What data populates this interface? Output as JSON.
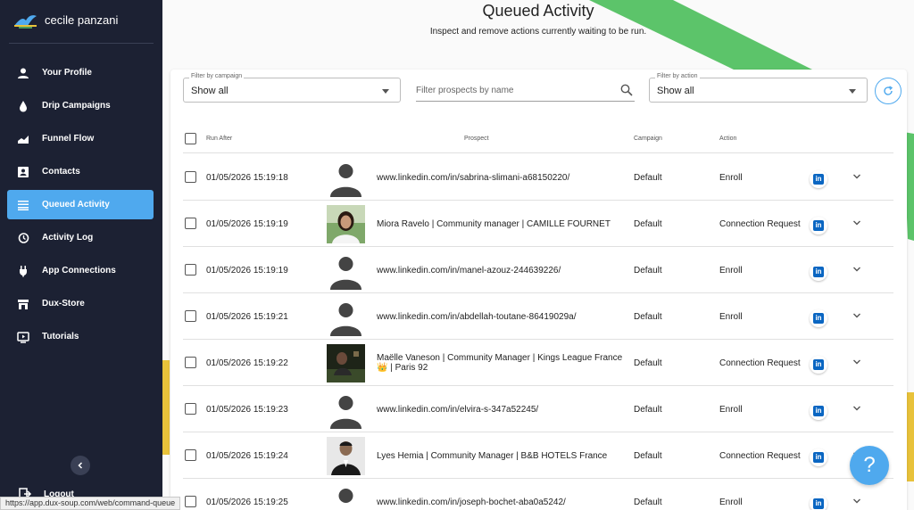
{
  "sidebar": {
    "user_name": "cecile panzani",
    "items": [
      {
        "label": "Your Profile",
        "icon": "person-icon",
        "active": false
      },
      {
        "label": "Drip Campaigns",
        "icon": "drop-icon",
        "active": false
      },
      {
        "label": "Funnel Flow",
        "icon": "chart-icon",
        "active": false
      },
      {
        "label": "Contacts",
        "icon": "contacts-icon",
        "active": false
      },
      {
        "label": "Queued Activity",
        "icon": "queue-icon",
        "active": true
      },
      {
        "label": "Activity Log",
        "icon": "history-icon",
        "active": false
      },
      {
        "label": "App Connections",
        "icon": "plug-icon",
        "active": false
      },
      {
        "label": "Dux-Store",
        "icon": "store-icon",
        "active": false
      },
      {
        "label": "Tutorials",
        "icon": "tutorial-icon",
        "active": false
      }
    ],
    "logout_label": "Logout"
  },
  "status_url": "https://app.dux-soup.com/web/command-queue",
  "header": {
    "title": "Queued Activity",
    "subtitle": "Inspect and remove actions currently waiting to be run."
  },
  "filters": {
    "campaign_label": "Filter by campaign",
    "campaign_value": "Show all",
    "search_placeholder": "Filter prospects by name",
    "action_label": "Filter by action",
    "action_value": "Show all"
  },
  "table": {
    "headers": {
      "run_after": "Run After",
      "prospect": "Prospect",
      "campaign": "Campaign",
      "action": "Action"
    },
    "rows": [
      {
        "time": "01/05/2026 15:19:18",
        "prospect": "www.linkedin.com/in/sabrina-slimani-a68150220/",
        "campaign": "Default",
        "action": "Enroll",
        "avatar": "placeholder"
      },
      {
        "time": "01/05/2026 15:19:19",
        "prospect": "Miora Ravelo | Community manager  | CAMILLE FOURNET",
        "campaign": "Default",
        "action": "Connection Request",
        "avatar": "photo"
      },
      {
        "time": "01/05/2026 15:19:19",
        "prospect": "www.linkedin.com/in/manel-azouz-244639226/",
        "campaign": "Default",
        "action": "Enroll",
        "avatar": "placeholder"
      },
      {
        "time": "01/05/2026 15:19:21",
        "prospect": "www.linkedin.com/in/abdellah-toutane-86419029a/",
        "campaign": "Default",
        "action": "Enroll",
        "avatar": "placeholder"
      },
      {
        "time": "01/05/2026 15:19:22",
        "prospect": "Maëlle Vaneson | Community Manager | Kings League France 👑 | Paris 92",
        "campaign": "Default",
        "action": "Connection Request",
        "avatar": "photo"
      },
      {
        "time": "01/05/2026 15:19:23",
        "prospect": "www.linkedin.com/in/elvira-s-347a52245/",
        "campaign": "Default",
        "action": "Enroll",
        "avatar": "placeholder"
      },
      {
        "time": "01/05/2026 15:19:24",
        "prospect": "Lyes Hemia | Community Manager  | B&B HOTELS France",
        "campaign": "Default",
        "action": "Connection Request",
        "avatar": "photo"
      },
      {
        "time": "01/05/2026 15:19:25",
        "prospect": "www.linkedin.com/in/joseph-bochet-aba0a5242/",
        "campaign": "Default",
        "action": "Enroll",
        "avatar": "placeholder"
      }
    ]
  },
  "linkedin_glyph": "in",
  "help_glyph": "?",
  "colors": {
    "sidebar": "#1c2133",
    "accent": "#4fa9ee",
    "green": "#5cc46a",
    "yellow": "#e8c23a",
    "linkedin": "#0a66c2"
  }
}
